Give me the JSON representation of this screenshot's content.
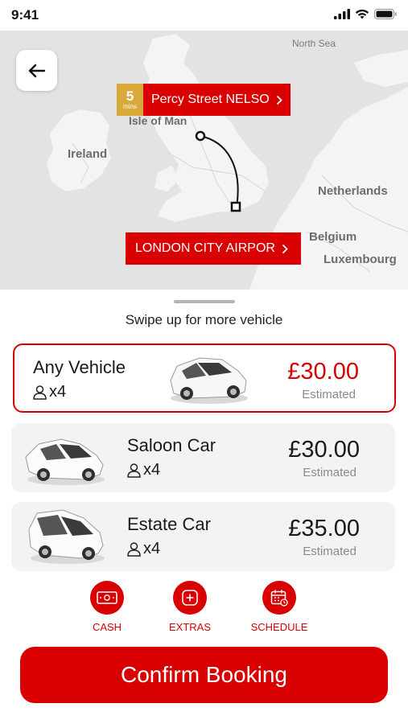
{
  "status_bar": {
    "time": "9:41"
  },
  "map": {
    "labels": {
      "north_sea": "North Sea",
      "ireland": "Ireland",
      "isle_of_man": "Isle of Man",
      "netherlands": "Netherlands",
      "belgium": "Belgium",
      "luxembourg": "Luxembourg"
    },
    "pickup": {
      "eta_value": "5",
      "eta_unit": "mins",
      "label": "Percy Street NELSO"
    },
    "dropoff": {
      "label": "LONDON CITY AIRPOR"
    }
  },
  "sheet": {
    "hint": "Swipe up for more vehicle",
    "vehicles": [
      {
        "name": "Any Vehicle",
        "passengers": "x4",
        "price": "£30.00",
        "price_note": "Estimated",
        "selected": true
      },
      {
        "name": "Saloon Car",
        "passengers": "x4",
        "price": "£30.00",
        "price_note": "Estimated",
        "selected": false
      },
      {
        "name": "Estate Car",
        "passengers": "x4",
        "price": "£35.00",
        "price_note": "Estimated",
        "selected": false
      }
    ],
    "options": [
      {
        "label": "CASH",
        "icon": "cash-icon"
      },
      {
        "label": "EXTRAS",
        "icon": "plus-icon"
      },
      {
        "label": "SCHEDULE",
        "icon": "calendar-icon"
      }
    ],
    "confirm_label": "Confirm Booking"
  },
  "colors": {
    "accent": "#d80000",
    "eta_badge": "#d9a93a",
    "map_bg": "#e3e3e3",
    "card_bg": "#f3f3f3"
  }
}
